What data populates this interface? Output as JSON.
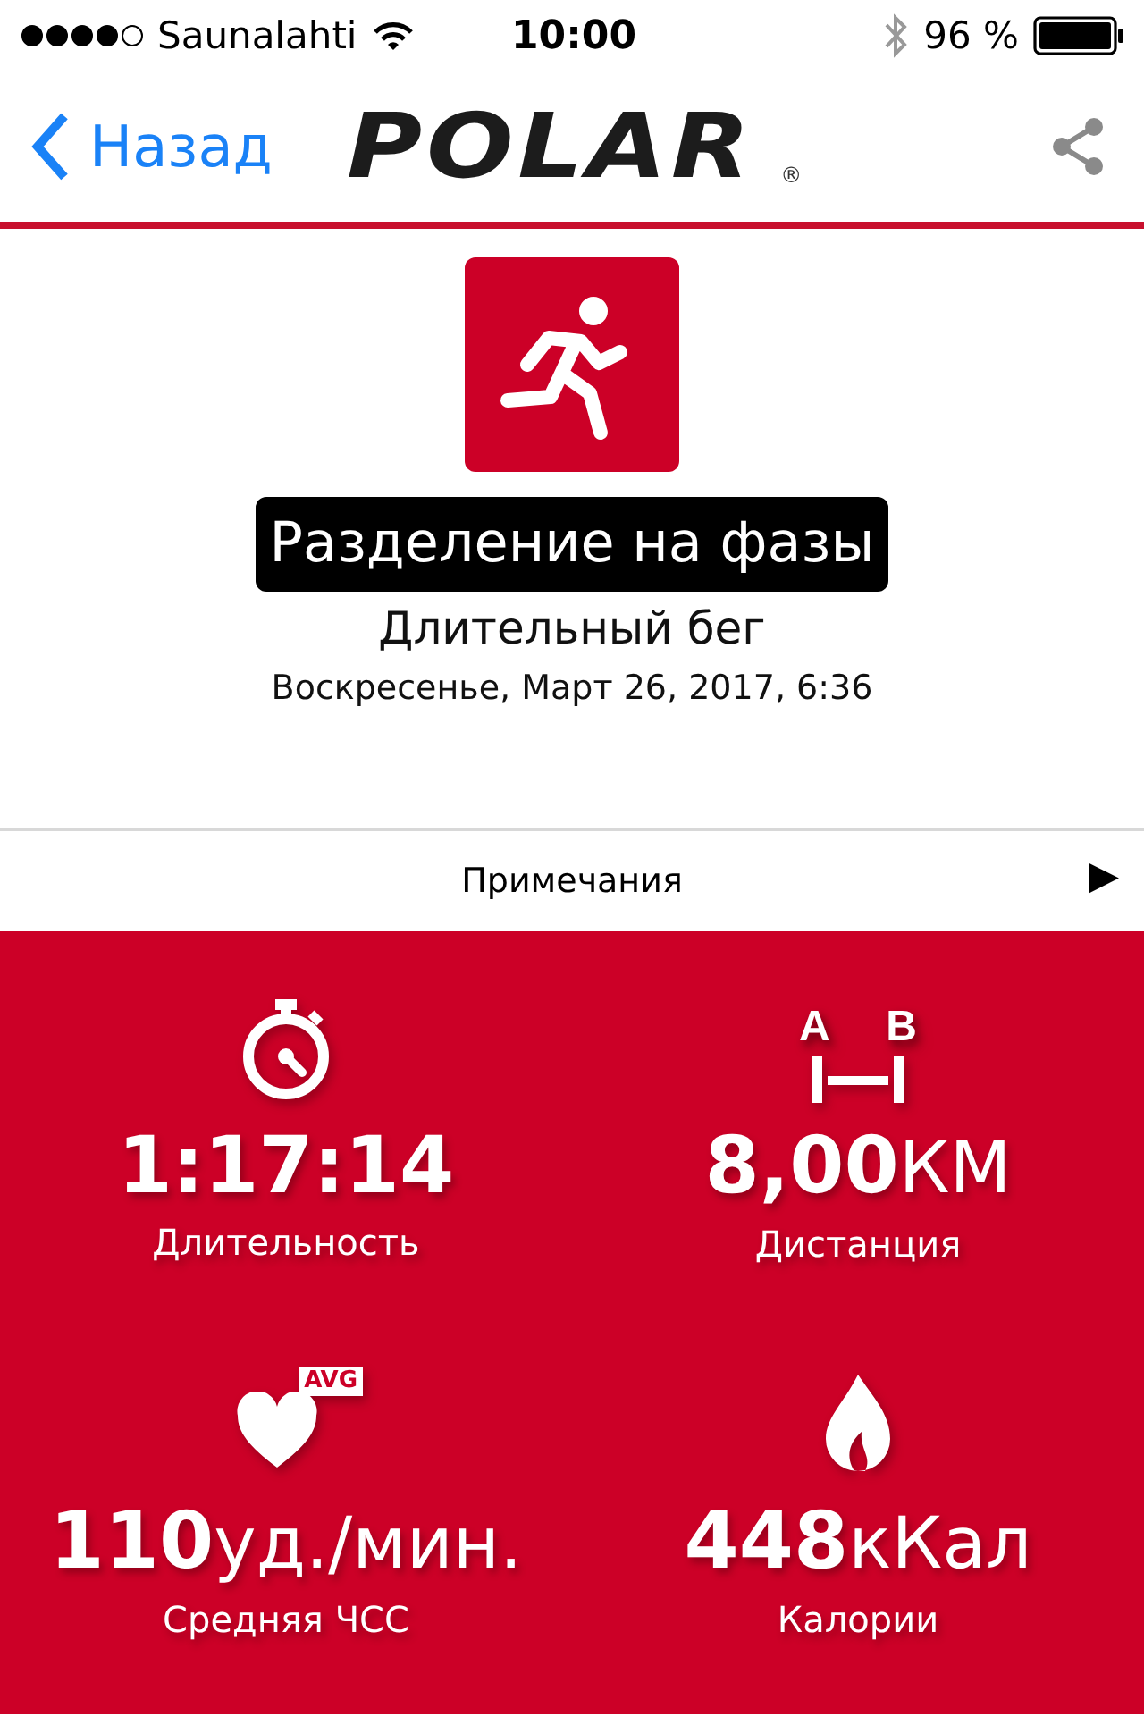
{
  "status_bar": {
    "carrier": "Saunalahti",
    "time": "10:00",
    "battery": "96 %"
  },
  "nav": {
    "back": "Назад",
    "logo": "POLAR",
    "logo_mark": "®"
  },
  "activity": {
    "title": "Разделение на фазы",
    "sport": "Длительный бег",
    "date": "Воскресенье, Март 26, 2017, 6:36"
  },
  "notes": {
    "label": "Примечания",
    "arrow": "▶"
  },
  "metrics": [
    {
      "kind": "stopwatch",
      "value": "1:17:14",
      "label": "Длительность"
    },
    {
      "kind": "distance",
      "icon_labels": [
        "A",
        "B"
      ],
      "value": "8,00",
      "unit": "КМ",
      "label": "Дистанция"
    },
    {
      "kind": "heart",
      "icon_labels": [
        "AVG"
      ],
      "value": "110",
      "unit": "уд./мин.",
      "label": "Средняя ЧСС"
    },
    {
      "kind": "flame",
      "value": "448",
      "unit": "кКал",
      "label": "Калории"
    }
  ]
}
